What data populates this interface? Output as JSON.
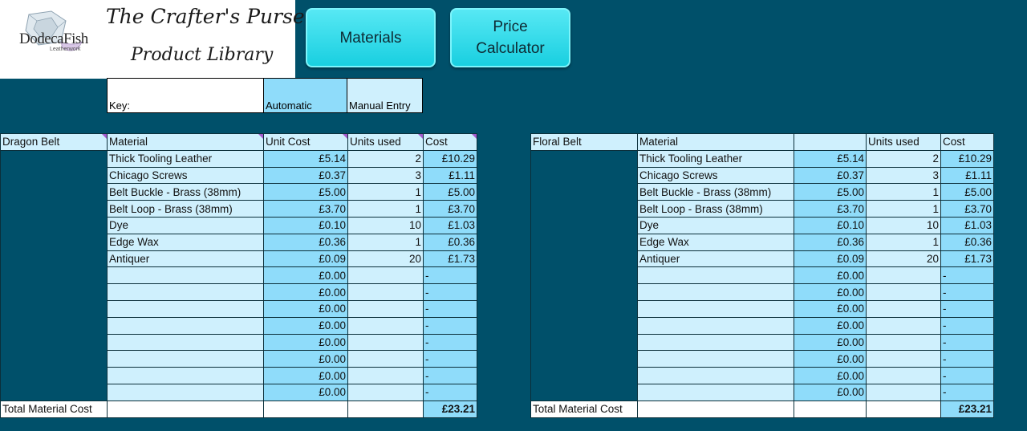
{
  "logo": {
    "word": "DodecaFish",
    "sub": "Leatherwork"
  },
  "title": {
    "line1": "The Crafter's Purse",
    "line2": "Product Library"
  },
  "buttons": {
    "materials": "Materials",
    "price": "Price\nCalculator"
  },
  "key": {
    "label": "Key:",
    "automatic": "Automatic",
    "manual": "Manual Entry"
  },
  "colors": {
    "background": "#00506a",
    "automatic": "#8fdcfa",
    "manual": "#cff0fd",
    "button": "#19cfe0"
  },
  "tables": [
    {
      "name": "Dragon Belt",
      "headers": {
        "material": "Material",
        "unit_cost": "Unit Cost",
        "units": "Units used",
        "cost": "Cost"
      },
      "rows": [
        [
          "Thick Tooling Leather",
          "£5.14",
          "2",
          "£10.29"
        ],
        [
          "Chicago Screws",
          "£0.37",
          "3",
          "£1.11"
        ],
        [
          "Belt Buckle - Brass (38mm)",
          "£5.00",
          "1",
          "£5.00"
        ],
        [
          "Belt Loop - Brass (38mm)",
          "£3.70",
          "1",
          "£3.70"
        ],
        [
          "Dye",
          "£0.10",
          "10",
          "£1.03"
        ],
        [
          "Edge Wax",
          "£0.36",
          "1",
          "£0.36"
        ],
        [
          "Antiquer",
          "£0.09",
          "20",
          "£1.73"
        ],
        [
          "",
          "£0.00",
          "",
          "-"
        ],
        [
          "",
          "£0.00",
          "",
          "-"
        ],
        [
          "",
          "£0.00",
          "",
          "-"
        ],
        [
          "",
          "£0.00",
          "",
          "-"
        ],
        [
          "",
          "£0.00",
          "",
          "-"
        ],
        [
          "",
          "£0.00",
          "",
          "-"
        ],
        [
          "",
          "£0.00",
          "",
          "-"
        ],
        [
          "",
          "£0.00",
          "",
          "-"
        ]
      ],
      "total_label": "Total Material Cost",
      "total": "£23.21"
    },
    {
      "name": "Floral Belt",
      "headers": {
        "material": "Material",
        "unit_cost": "",
        "units": "Units used",
        "cost": "Cost"
      },
      "rows": [
        [
          "Thick Tooling Leather",
          "£5.14",
          "2",
          "£10.29"
        ],
        [
          "Chicago Screws",
          "£0.37",
          "3",
          "£1.11"
        ],
        [
          "Belt Buckle - Brass (38mm)",
          "£5.00",
          "1",
          "£5.00"
        ],
        [
          "Belt Loop - Brass (38mm)",
          "£3.70",
          "1",
          "£3.70"
        ],
        [
          "Dye",
          "£0.10",
          "10",
          "£1.03"
        ],
        [
          "Edge Wax",
          "£0.36",
          "1",
          "£0.36"
        ],
        [
          "Antiquer",
          "£0.09",
          "20",
          "£1.73"
        ],
        [
          "",
          "£0.00",
          "",
          "-"
        ],
        [
          "",
          "£0.00",
          "",
          "-"
        ],
        [
          "",
          "£0.00",
          "",
          "-"
        ],
        [
          "",
          "£0.00",
          "",
          "-"
        ],
        [
          "",
          "£0.00",
          "",
          "-"
        ],
        [
          "",
          "£0.00",
          "",
          "-"
        ],
        [
          "",
          "£0.00",
          "",
          "-"
        ],
        [
          "",
          "£0.00",
          "",
          "-"
        ]
      ],
      "total_label": "Total Material Cost",
      "total": "£23.21"
    }
  ]
}
